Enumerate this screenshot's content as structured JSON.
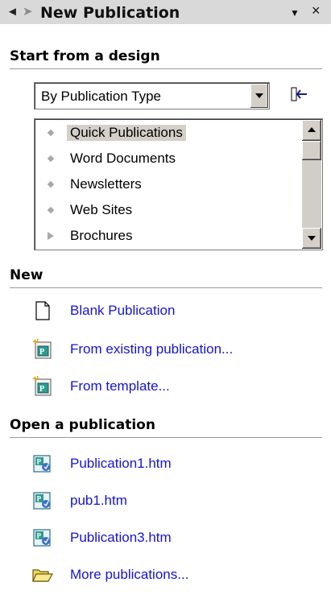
{
  "titlebar": {
    "back_icon": "back-arrow-icon",
    "forward_icon": "forward-arrow-icon",
    "title": "New Publication",
    "dropdown_icon": "chevron-down-icon",
    "close_icon": "close-icon"
  },
  "start_section": {
    "heading": "Start from a design",
    "combo_value": "By Publication Type",
    "list_items": [
      {
        "label": "Quick Publications",
        "selected": true
      },
      {
        "label": "Word Documents"
      },
      {
        "label": "Newsletters"
      },
      {
        "label": "Web Sites"
      },
      {
        "label": "Brochures"
      }
    ]
  },
  "new_section": {
    "heading": "New",
    "items": [
      {
        "label": "Blank Publication",
        "icon": "blank-page-icon"
      },
      {
        "label": "From existing publication...",
        "icon": "publication-wizard-icon"
      },
      {
        "label": "From template...",
        "icon": "publication-wizard-icon"
      }
    ]
  },
  "open_section": {
    "heading": "Open a publication",
    "items": [
      {
        "label": "Publication1.htm",
        "icon": "publisher-file-icon"
      },
      {
        "label": "pub1.htm",
        "icon": "publisher-file-icon"
      },
      {
        "label": "Publication3.htm",
        "icon": "publisher-file-icon"
      },
      {
        "label": "More publications...",
        "icon": "open-folder-icon"
      }
    ]
  },
  "colors": {
    "link": "#1414d4",
    "titlebar": "#d9d9d9",
    "selection": "#d4d0c8"
  }
}
